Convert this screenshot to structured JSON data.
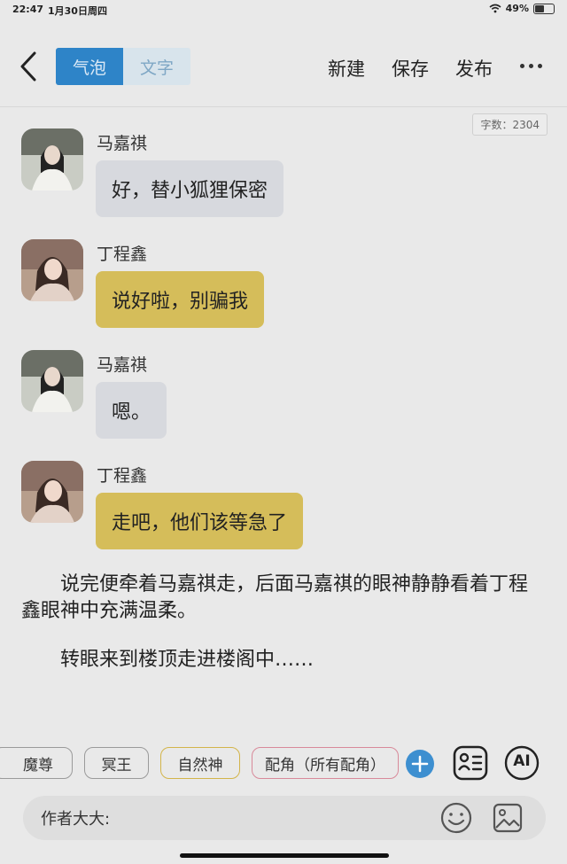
{
  "status": {
    "time": "22:47",
    "date": "1月30日周四",
    "battery_pct": "49%",
    "battery_level": 0.49
  },
  "toolbar": {
    "tab_bubble": "气泡",
    "tab_text": "文字",
    "new_label": "新建",
    "save_label": "保存",
    "publish_label": "发布"
  },
  "word_count": "字数：2304",
  "messages": [
    {
      "sender": "马嘉祺",
      "text": "好，替小狐狸保密",
      "style": "grey"
    },
    {
      "sender": "丁程鑫",
      "text": "说好啦，别骗我",
      "style": "yellow"
    },
    {
      "sender": "马嘉祺",
      "text": "嗯。",
      "style": "grey"
    },
    {
      "sender": "丁程鑫",
      "text": "走吧，他们该等急了",
      "style": "yellow"
    }
  ],
  "narration": [
    "　　说完便牵着马嘉祺走，后面马嘉祺的眼神静静看着丁程鑫眼神中充满温柔。",
    "　　转眼来到楼顶走进楼阁中……"
  ],
  "chips": [
    "魔尊",
    "冥王",
    "自然神",
    "配角（所有配角）"
  ],
  "ai_label": "AI",
  "input": {
    "label": "作者大大:"
  },
  "colors": {
    "accent_blue": "#2e84c8",
    "bubble_grey": "#d7d9de",
    "bubble_yellow": "#d5bd5a"
  }
}
